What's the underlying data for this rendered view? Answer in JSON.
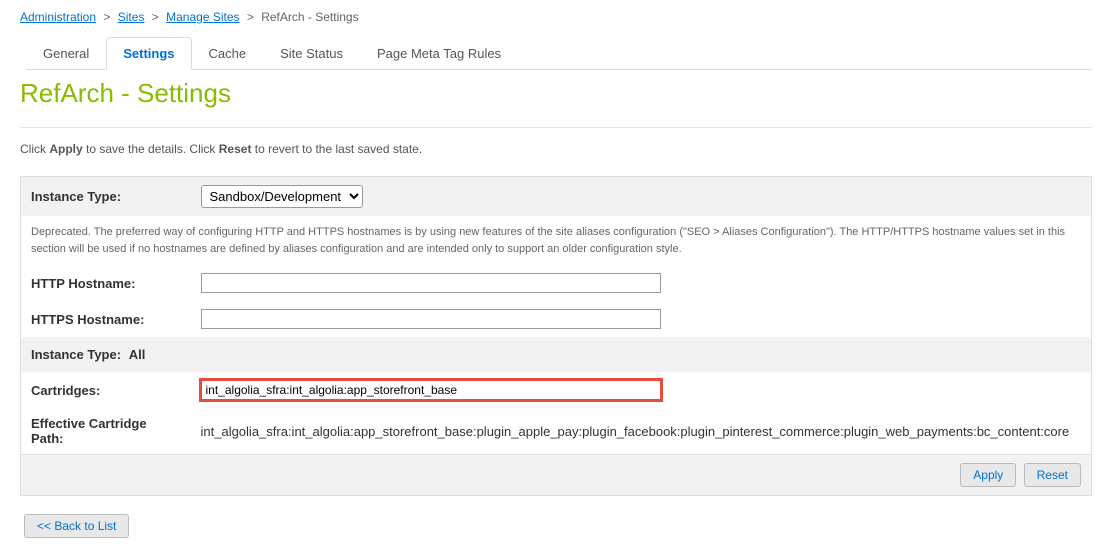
{
  "breadcrumb": {
    "items": [
      {
        "label": "Administration"
      },
      {
        "label": "Sites"
      },
      {
        "label": "Manage Sites"
      }
    ],
    "current": "RefArch - Settings"
  },
  "tabs": {
    "general": "General",
    "settings": "Settings",
    "cache": "Cache",
    "site_status": "Site Status",
    "page_meta": "Page Meta Tag Rules"
  },
  "page_title": "RefArch - Settings",
  "help_text": {
    "prefix": "Click ",
    "apply": "Apply",
    "mid": " to save the details. Click ",
    "reset": "Reset",
    "suffix": " to revert to the last saved state."
  },
  "form": {
    "instance_type_label": "Instance Type:",
    "instance_type_value": "Sandbox/Development",
    "deprecated_note": "Deprecated. The preferred way of configuring HTTP and HTTPS hostnames is by using new features of the site aliases configuration (\"SEO > Aliases Configuration\"). The HTTP/HTTPS hostname values set in this section will be used if no hostnames are defined by aliases configuration and are intended only to support an older configuration style.",
    "http_hostname_label": "HTTP Hostname:",
    "http_hostname_value": "",
    "https_hostname_label": "HTTPS Hostname:",
    "https_hostname_value": "",
    "instance_type_all_label": "Instance Type:",
    "instance_type_all_value": "All",
    "cartridges_label": "Cartridges:",
    "cartridges_value": "int_algolia_sfra:int_algolia:app_storefront_base",
    "effective_path_label": "Effective Cartridge Path:",
    "effective_path_value": "int_algolia_sfra:int_algolia:app_storefront_base:plugin_apple_pay:plugin_facebook:plugin_pinterest_commerce:plugin_web_payments:bc_content:core"
  },
  "buttons": {
    "apply": "Apply",
    "reset": "Reset",
    "back": "<< Back to List"
  }
}
